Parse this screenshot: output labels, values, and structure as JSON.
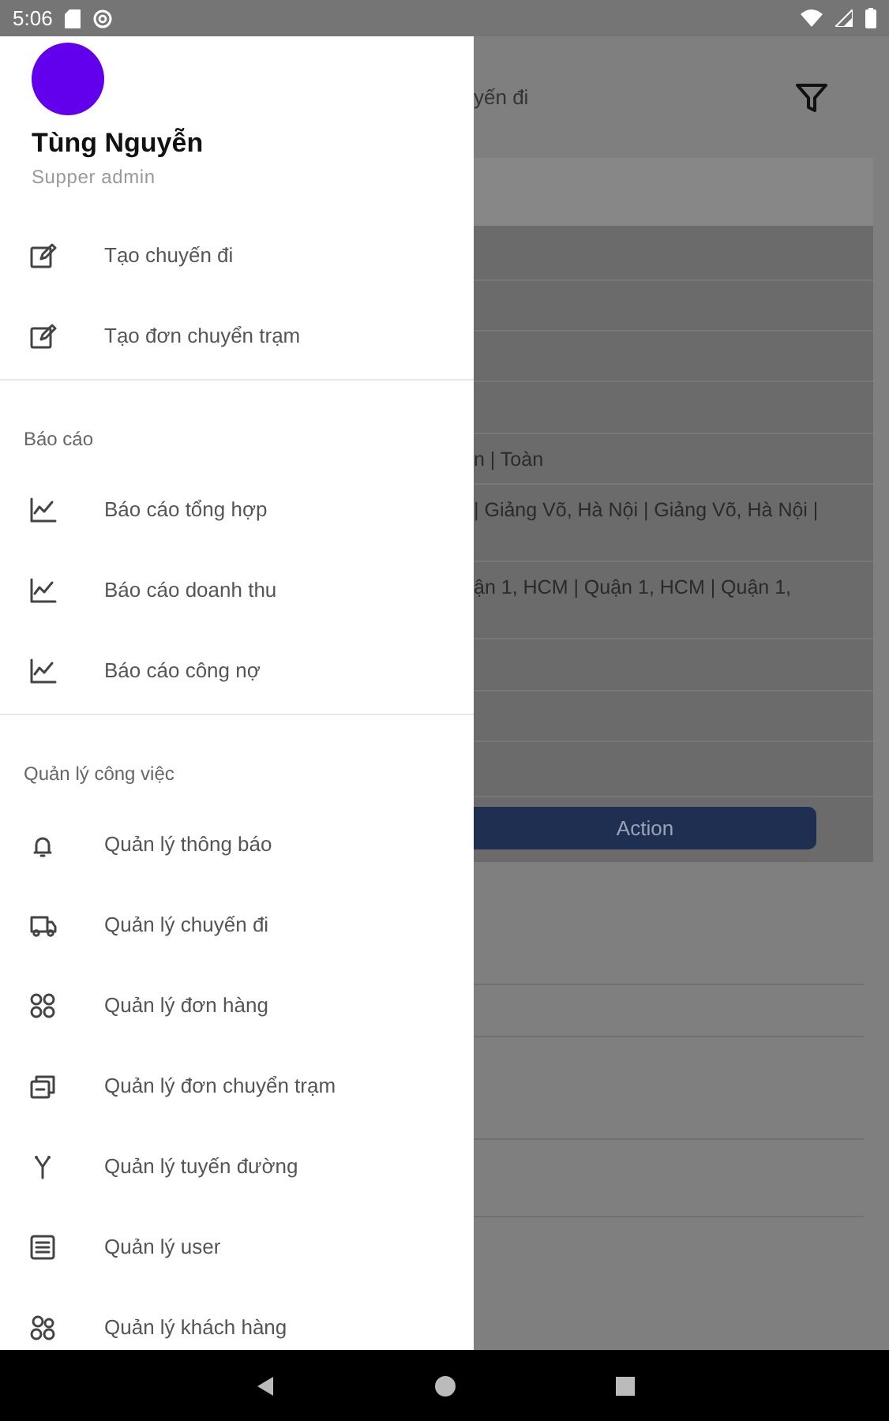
{
  "status_bar": {
    "time": "5:06"
  },
  "drawer": {
    "user": {
      "name": "Tùng Nguyễn",
      "role": "Supper admin"
    },
    "sections": [
      {
        "items": [
          {
            "label": "Tạo chuyến đi"
          },
          {
            "label": "Tạo đơn chuyển trạm"
          }
        ]
      },
      {
        "header": "Báo cáo",
        "items": [
          {
            "label": "Báo cáo tổng hợp"
          },
          {
            "label": "Báo cáo doanh thu"
          },
          {
            "label": "Báo cáo công nợ"
          }
        ]
      },
      {
        "header": "Quản lý công việc",
        "items": [
          {
            "label": "Quản lý thông báo"
          },
          {
            "label": "Quản lý chuyến đi"
          },
          {
            "label": "Quản lý đơn hàng"
          },
          {
            "label": "Quản lý đơn chuyển trạm"
          },
          {
            "label": "Quản lý tuyến đường"
          },
          {
            "label": "Quản lý user"
          },
          {
            "label": "Quản lý khách hàng"
          }
        ]
      }
    ]
  },
  "background": {
    "title": "yến đi",
    "table_rows": [
      {
        "text": "n | Toàn"
      },
      {
        "text": "| Giảng Võ, Hà Nội | Giảng Võ, Hà Nội |"
      },
      {
        "text": "ận 1, HCM | Quận 1, HCM | Quận 1,"
      }
    ],
    "action_button": "Action"
  }
}
